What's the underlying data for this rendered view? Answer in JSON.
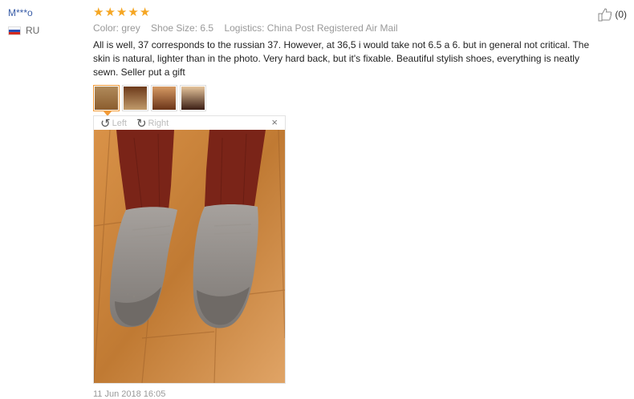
{
  "review": {
    "user_name": "M***o",
    "country": "RU",
    "rating": 5,
    "color": "Color: grey",
    "shoe_size": "Shoe Size: 6.5",
    "logistics": "Logistics: China Post Registered Air Mail",
    "text": "All is well, 37 corresponds to the russian 37. However, at 36,5 i would take not 6.5 a 6. but in general not critical. The skin is natural, lighter than in the photo. Very hard back, but it's fixable. Beautiful stylish shoes, everything is neatly sewn. Seller put a gift",
    "helpful_count": "(0)",
    "date": "11 Jun 2018 16:05"
  },
  "viewer": {
    "left_label": "Left",
    "right_label": "Right",
    "close_label": "×"
  },
  "thumbnails": [
    {
      "active": true
    },
    {
      "active": false
    },
    {
      "active": false
    },
    {
      "active": false
    }
  ],
  "colors": {
    "user_link": "#3a5ea8",
    "star": "#f5a623",
    "active_thumb_border": "#f29b38",
    "meta_text": "#999999"
  }
}
